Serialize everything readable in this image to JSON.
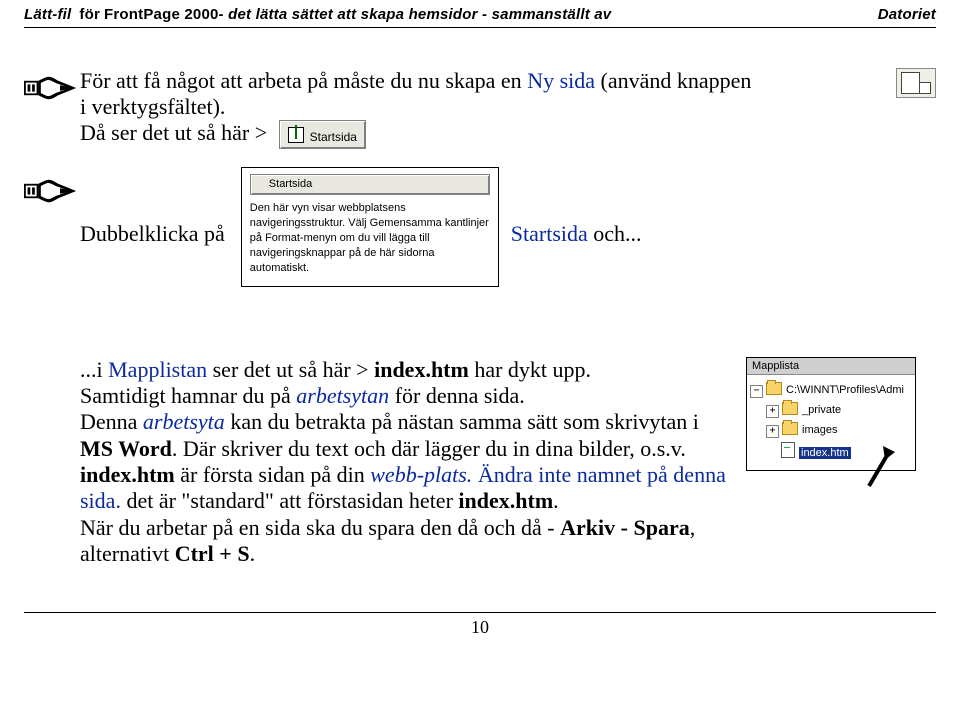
{
  "header": {
    "lead_word": "Lätt-fil",
    "for_word": "för",
    "product": "FrontPage 2000",
    "subtitle": " - det lätta sättet att skapa hemsidor - sammanställt av ",
    "brand": "Datoriet"
  },
  "block1": {
    "line_a_pre": "För att få något att arbeta på  måste du nu skapa en ",
    "ny_sida": "Ny sida",
    "line_a_post": " (använd knappen",
    "line_b": "i verktygsfältet).",
    "line_c": "Då ser det ut så här >"
  },
  "startsida_tile_label": "Startsida",
  "block2": {
    "pre": "Dubbelklicka på",
    "post_a": "Startsida",
    "post_b": " och..."
  },
  "fp_hint": {
    "btn": "Startsida",
    "text": "Den här vyn visar webbplatsens navigeringsstruktur. Välj Gemensamma kantlinjer på Format-menyn om du vill lägga till navigeringsknappar på de här sidorna automatiskt."
  },
  "mapplista": {
    "header": "Mapplista",
    "root": "C:\\WINNT\\Profiles\\Admi",
    "items": [
      "_private",
      "images",
      "index.htm"
    ]
  },
  "lower_para": {
    "l1_a": "...i ",
    "l1_b": "Mapplistan",
    "l1_c": " ser det ut så här > ",
    "l1_d": "index.htm",
    "l1_e": " har dykt upp.",
    "l2_a": "Samtidigt hamnar du på ",
    "l2_b": "arbetsytan",
    "l2_c": " för denna sida.",
    "l3_a": "Denna ",
    "l3_b": "arbetsyta",
    "l3_c": " kan du betrakta på nästan samma sätt som skrivytan i ",
    "l3_d": "MS Word",
    "l3_e": ". Där skriver du text och där lägger du in dina bilder, o.s.v.",
    "l4_a": "index.htm",
    "l4_b": " är första sidan på din ",
    "l4_c": "webb-plats.",
    "l4_d": " Ändra inte namnet på denna sida.",
    "l4_e": " det är \"standard\" att förstasidan heter ",
    "l4_f": "index.htm",
    "l4_g": ".",
    "l5_a": "När du arbetar på en sida ska du spara den då och då - ",
    "l5_b": "Arkiv - Spara",
    "l5_c": ", alternativt ",
    "l5_d": "Ctrl + S",
    "l5_e": "."
  },
  "page_number": "10"
}
